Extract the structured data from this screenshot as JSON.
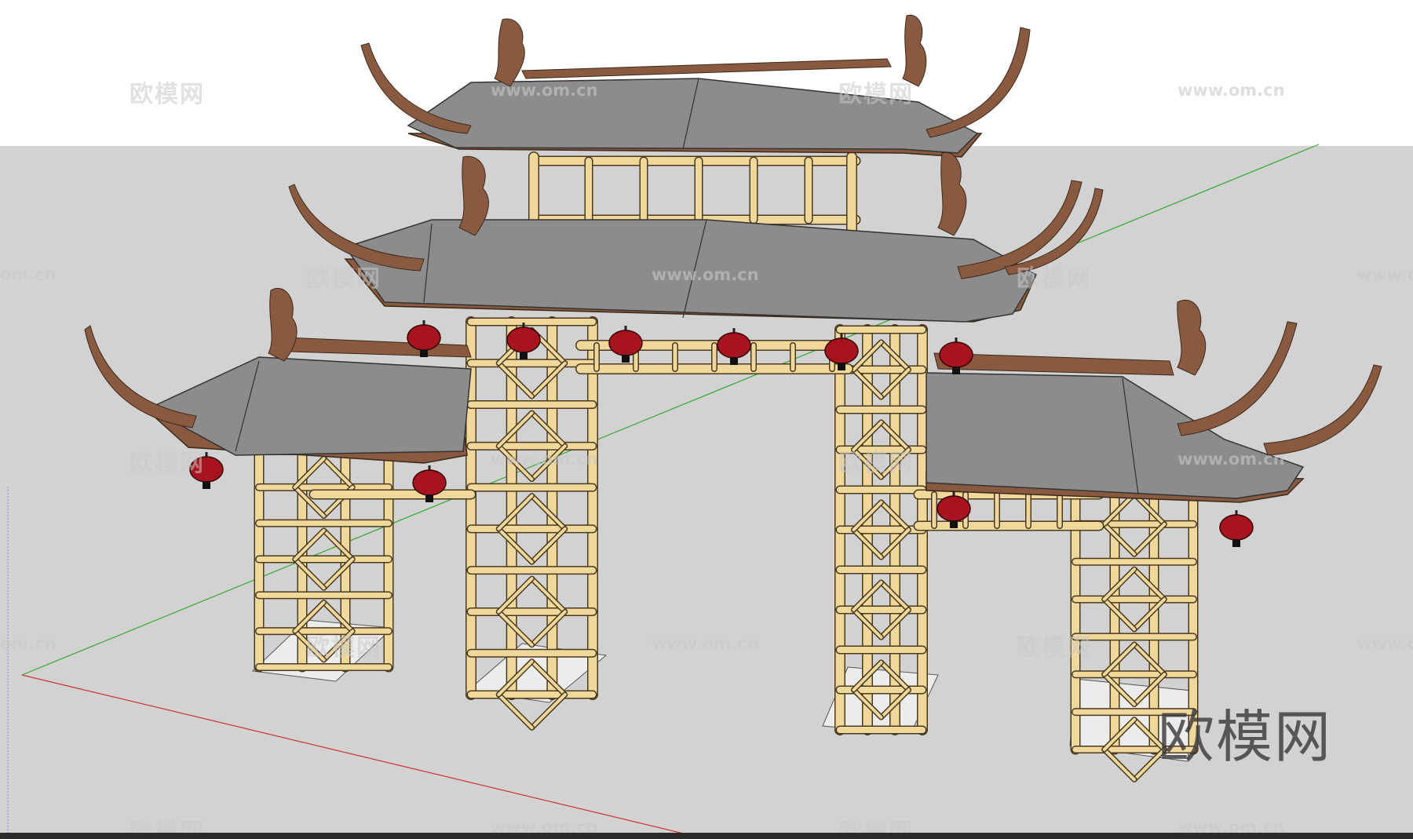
{
  "watermark": {
    "cn_text": "欧模网",
    "url_text": "www.om.cn",
    "partial_url_text": "om.cn",
    "brand_text": "欧模网"
  },
  "colors": {
    "sky": "#ffffff",
    "ground": "#d2d2d2",
    "roof": "#888888",
    "eave": "#8a5a40",
    "bamboo": "#f0d79a",
    "bamboo_edge": "#4a3a20",
    "lantern": "#a8141e",
    "axis_green": "#33aa33",
    "axis_red": "#cc3333"
  }
}
